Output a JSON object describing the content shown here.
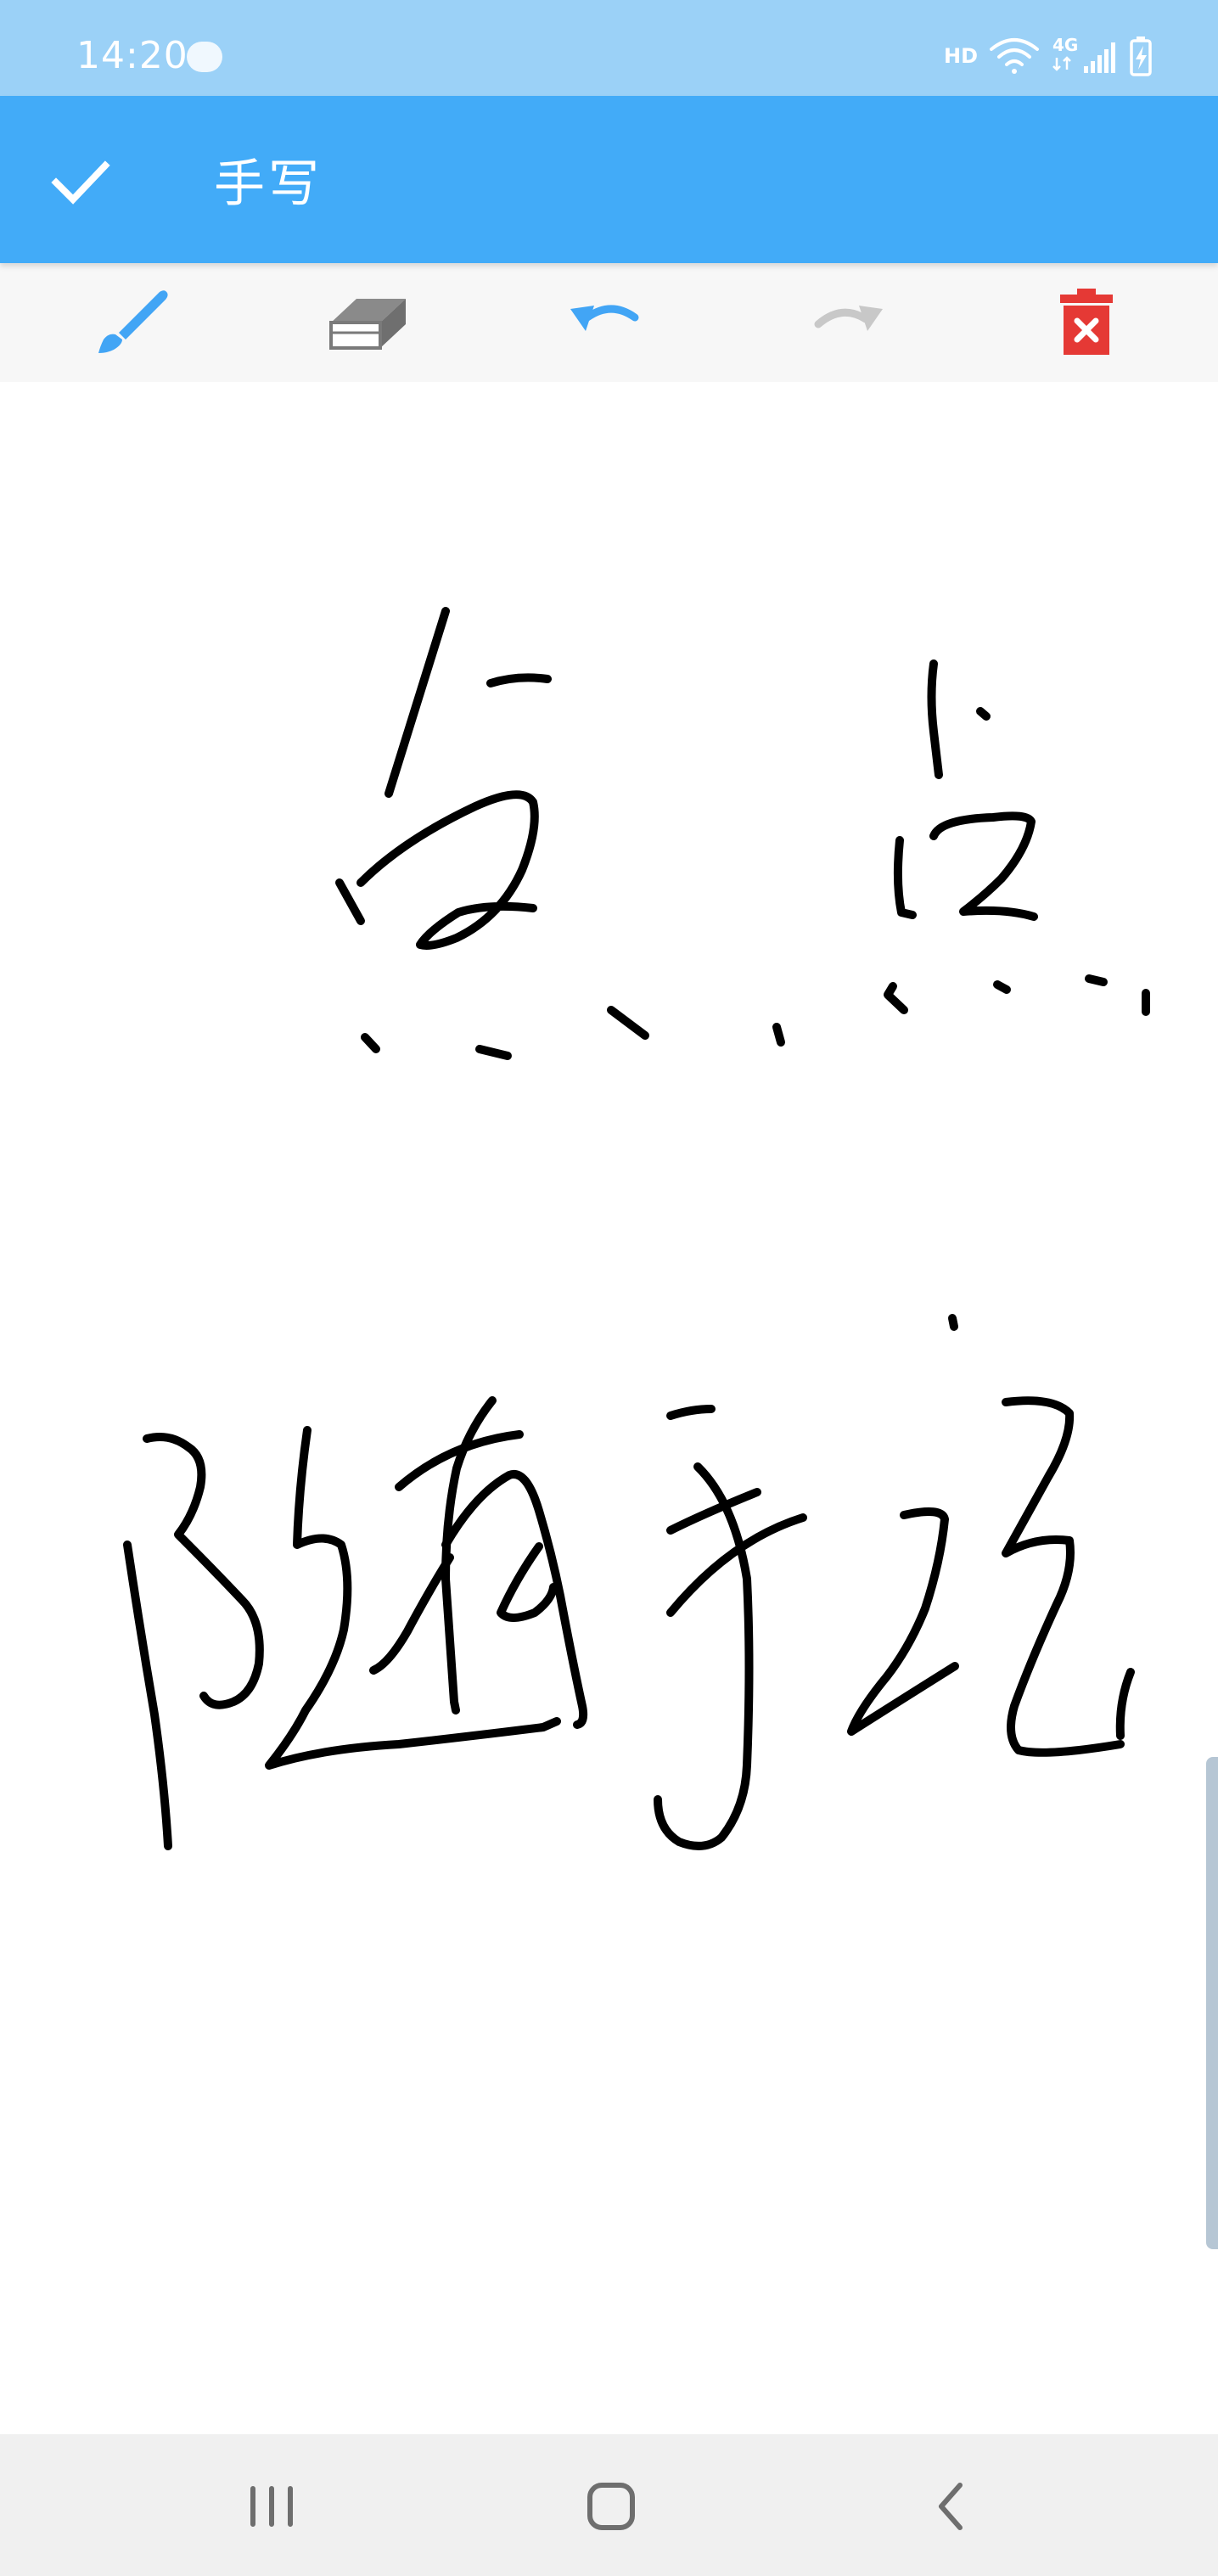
{
  "status_bar": {
    "time": "14:20",
    "network_label": "HD",
    "cell_label": "4G"
  },
  "app_bar": {
    "title": "手写",
    "confirm_icon": "check-icon"
  },
  "toolbar": {
    "tools": [
      {
        "name": "brush",
        "icon": "brush-icon",
        "color": "#42a5f5",
        "active": true
      },
      {
        "name": "eraser",
        "icon": "eraser-icon",
        "color": "#8a8a8a"
      },
      {
        "name": "undo",
        "icon": "undo-icon",
        "color": "#42a5f5",
        "enabled": true
      },
      {
        "name": "redo",
        "icon": "redo-icon",
        "color": "#c8c8c8",
        "enabled": false
      },
      {
        "name": "clear",
        "icon": "trash-icon",
        "color": "#e53935"
      }
    ]
  },
  "canvas": {
    "ink_color": "#000000",
    "background": "#ffffff"
  },
  "nav_bar": {
    "buttons": [
      "recent-apps-icon",
      "home-icon",
      "back-icon"
    ]
  },
  "colors": {
    "status_bar": "#9bd1f7",
    "app_bar": "#42abf8",
    "toolbar": "#f7f7f7",
    "nav_bar": "#f0f0f0"
  }
}
